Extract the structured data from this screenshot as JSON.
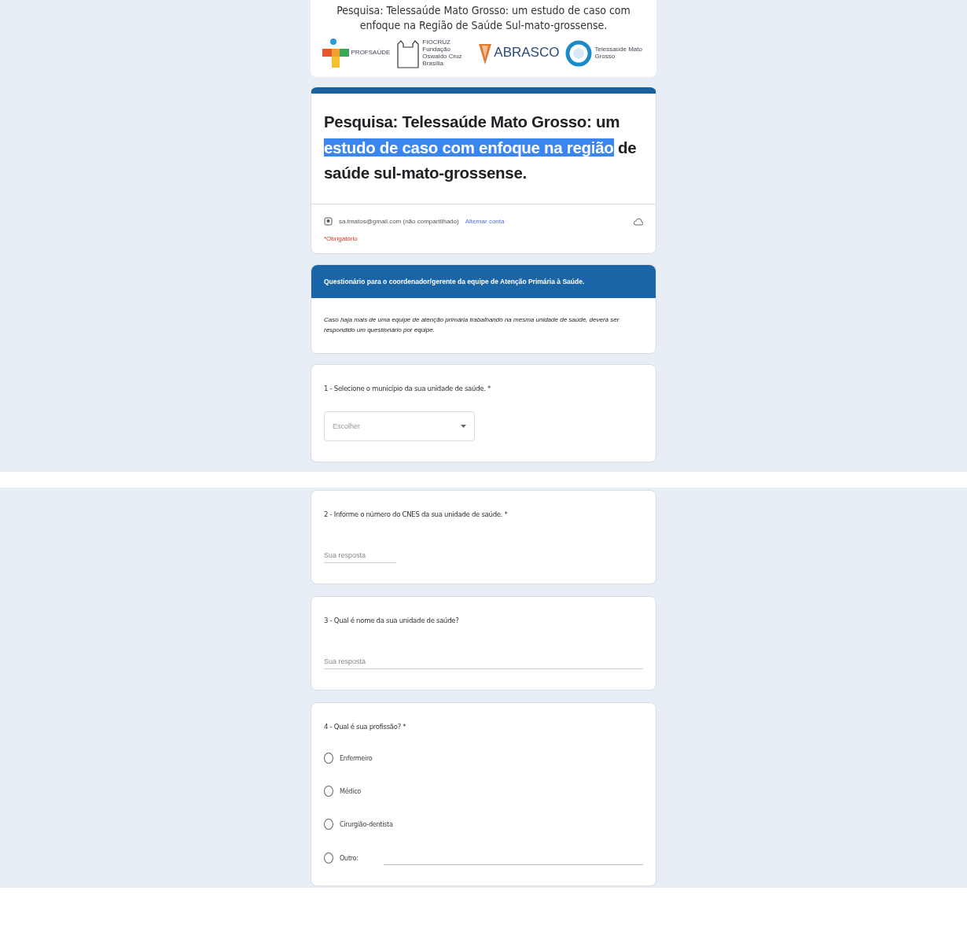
{
  "banner": {
    "caption": "Pesquisa: Telessaúde Mato Grosso: um estudo de caso com enfoque na Região de Saúde Sul-mato-grossense.",
    "logos": [
      {
        "kind": "cross",
        "text": "PROFSAÚDE"
      },
      {
        "kind": "building",
        "text": "FIOCRUZ Fundação Oswaldo Cruz Brasília"
      },
      {
        "kind": "flag",
        "text": "ABRASCO"
      },
      {
        "kind": "ring",
        "text": "Telessaúde Mato Grosso"
      }
    ]
  },
  "form_title": [
    {
      "text": "Pesquisa: Telessaúde Mato Grosso: um ",
      "selected": false
    },
    {
      "text": "estudo de caso com enfoque na região",
      "selected": true
    },
    {
      "text": " de saúde sul-mato-grossense.",
      "selected": false
    }
  ],
  "account": {
    "email": "sa.tmatos@gmail.com",
    "note": "(não compartilhado)",
    "switch_link": "Alternar conta",
    "required_note": "*Obrigatório"
  },
  "section": {
    "title": "Questionário para o coordenador/gerente da equipe de Atenção Primária à Saúde.",
    "description": "Caso haja mais de uma equipe de atenção primária trabalhando na mesma unidade de saúde, deverá ser respondido um questionário por equipe."
  },
  "screens": [
    {
      "questions": [
        {
          "kind": "dropdown",
          "label": "1 - Selecione o município da sua unidade de saúde. *",
          "placeholder": "Escolher"
        }
      ]
    },
    {
      "questions": [
        {
          "kind": "text",
          "label": "2 - Informe o número do CNES da sua unidade de saúde. *",
          "placeholder": "Sua resposta",
          "short": true
        },
        {
          "kind": "text",
          "label": "3 - Qual é nome da sua unidade de saúde?",
          "placeholder": "Sua resposta",
          "short": false
        },
        {
          "kind": "radio",
          "label": "4 - Qual é sua profissão? *",
          "options": [
            {
              "label": "Enfermeiro",
              "selected": false,
              "other": false
            },
            {
              "label": "Médico",
              "selected": false,
              "other": false
            },
            {
              "label": "Cirurgião-dentista",
              "selected": false,
              "other": false
            },
            {
              "label": "Outro:",
              "selected": false,
              "other": true
            }
          ]
        }
      ]
    }
  ]
}
